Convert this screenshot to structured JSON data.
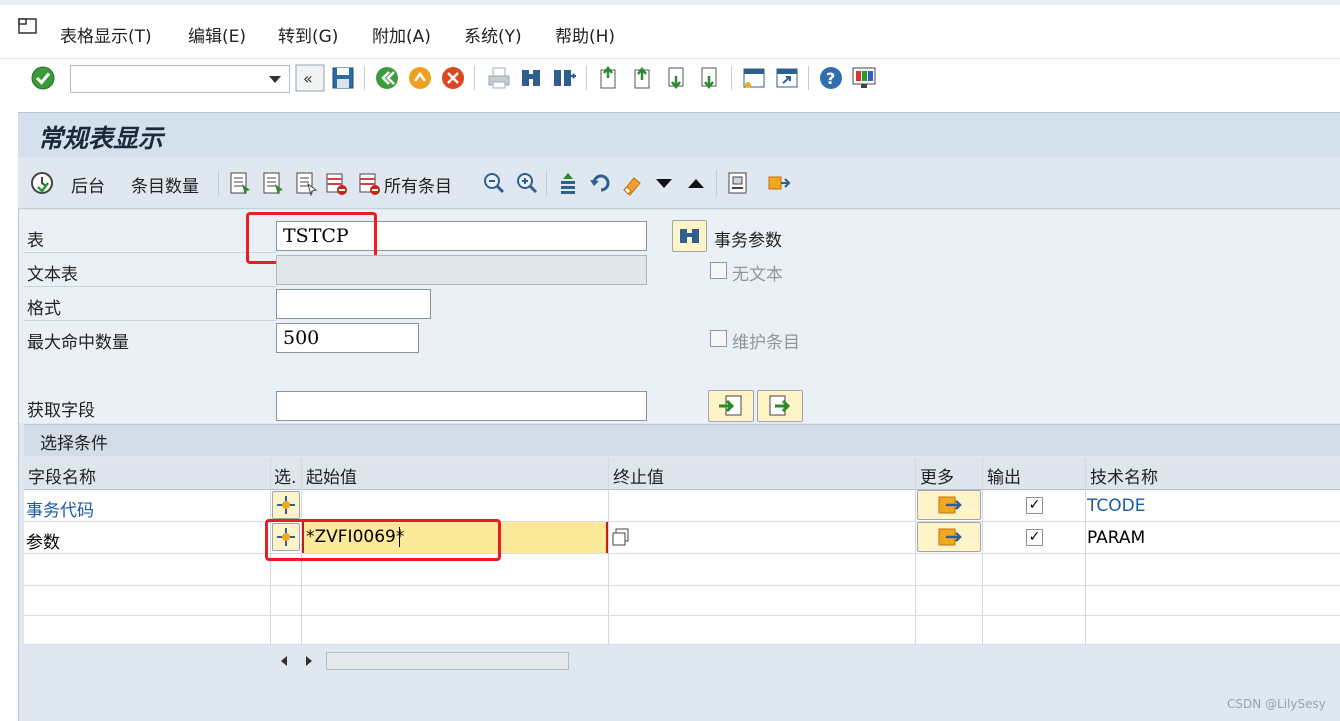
{
  "menu": {
    "items": [
      "表格显示(T)",
      "编辑(E)",
      "转到(G)",
      "附加(A)",
      "系统(Y)",
      "帮助(H)"
    ]
  },
  "screen": {
    "title": "常规表显示"
  },
  "app_toolbar": {
    "background_label": "后台",
    "entry_count_label": "条目数量",
    "all_entries_label": "所有条目"
  },
  "form": {
    "table_label": "表",
    "table_value": "TSTCP",
    "text_table_label": "文本表",
    "text_table_value": "",
    "format_label": "格式",
    "format_value": "",
    "max_hits_label": "最大命中数量",
    "max_hits_value": "500",
    "get_fields_label": "获取字段",
    "get_fields_value": "",
    "transaction_params_label": "事务参数",
    "no_text_label": "无文本",
    "no_text_checked": false,
    "maintain_entries_label": "维护条目",
    "maintain_entries_checked": false
  },
  "selection": {
    "section_title": "选择条件",
    "columns": {
      "field_name": "字段名称",
      "select": "选.",
      "from": "起始值",
      "to": "终止值",
      "more": "更多",
      "output": "输出",
      "tech_name": "技术名称"
    },
    "rows": [
      {
        "field": "事务代码",
        "from": "",
        "to": "",
        "output": true,
        "tech": "TCODE"
      },
      {
        "field": "参数",
        "from": "*ZVFI0069*",
        "to": "",
        "output": true,
        "tech": "PARAM"
      }
    ]
  },
  "watermark": "CSDN @LilySesy",
  "colors": {
    "accent_red": "#ea1c24",
    "link_blue": "#1b5aa6",
    "screen_bg": "#dfe8f0",
    "header_bg": "#d4e0eb"
  }
}
